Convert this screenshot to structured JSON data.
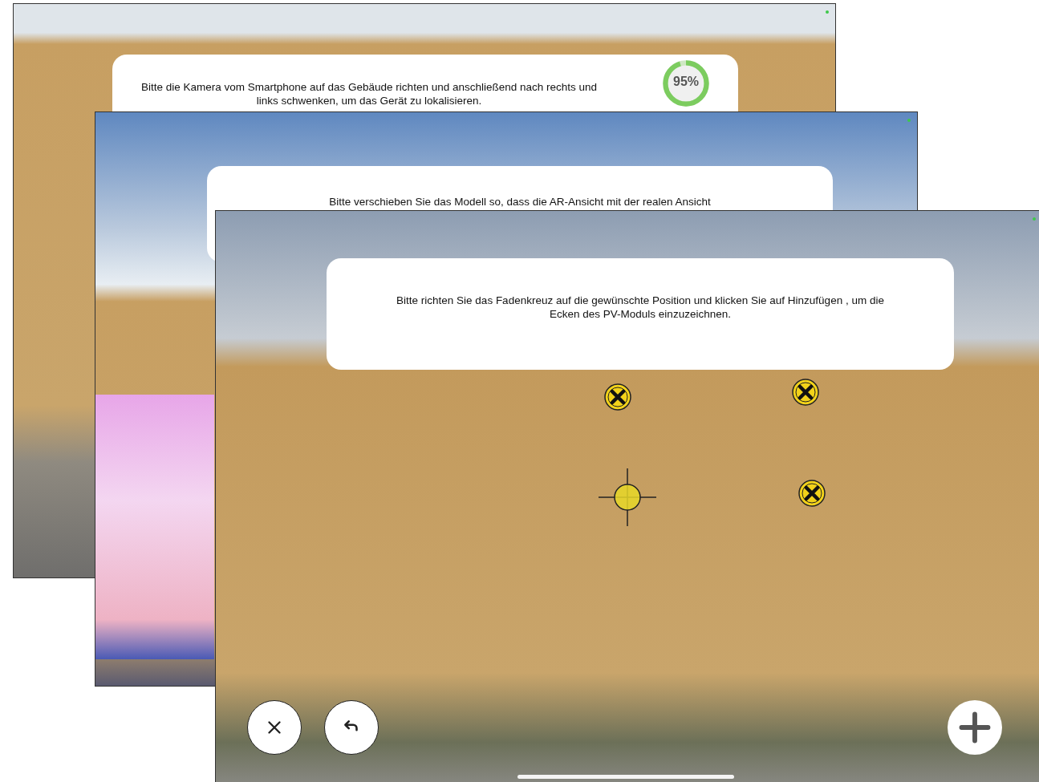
{
  "screens": [
    {
      "kind": "localize",
      "instruction": "Bitte die Kamera vom Smartphone auf das Gebäude richten und anschließend nach rechts und links schwenken, um das Gerät zu lokalisieren.",
      "progress": {
        "level": 0.95,
        "label": "95%"
      }
    },
    {
      "kind": "align",
      "instruction": "Bitte verschieben Sie das Modell so, dass die AR-Ansicht mit der realen Ansicht"
    },
    {
      "kind": "corners",
      "instruction": "Bitte richten Sie das Fadenkreuz auf die gewünschte Position und klicken Sie auf Hinzufügen , um die Ecken des PV-Moduls einzuzeichnen."
    }
  ]
}
